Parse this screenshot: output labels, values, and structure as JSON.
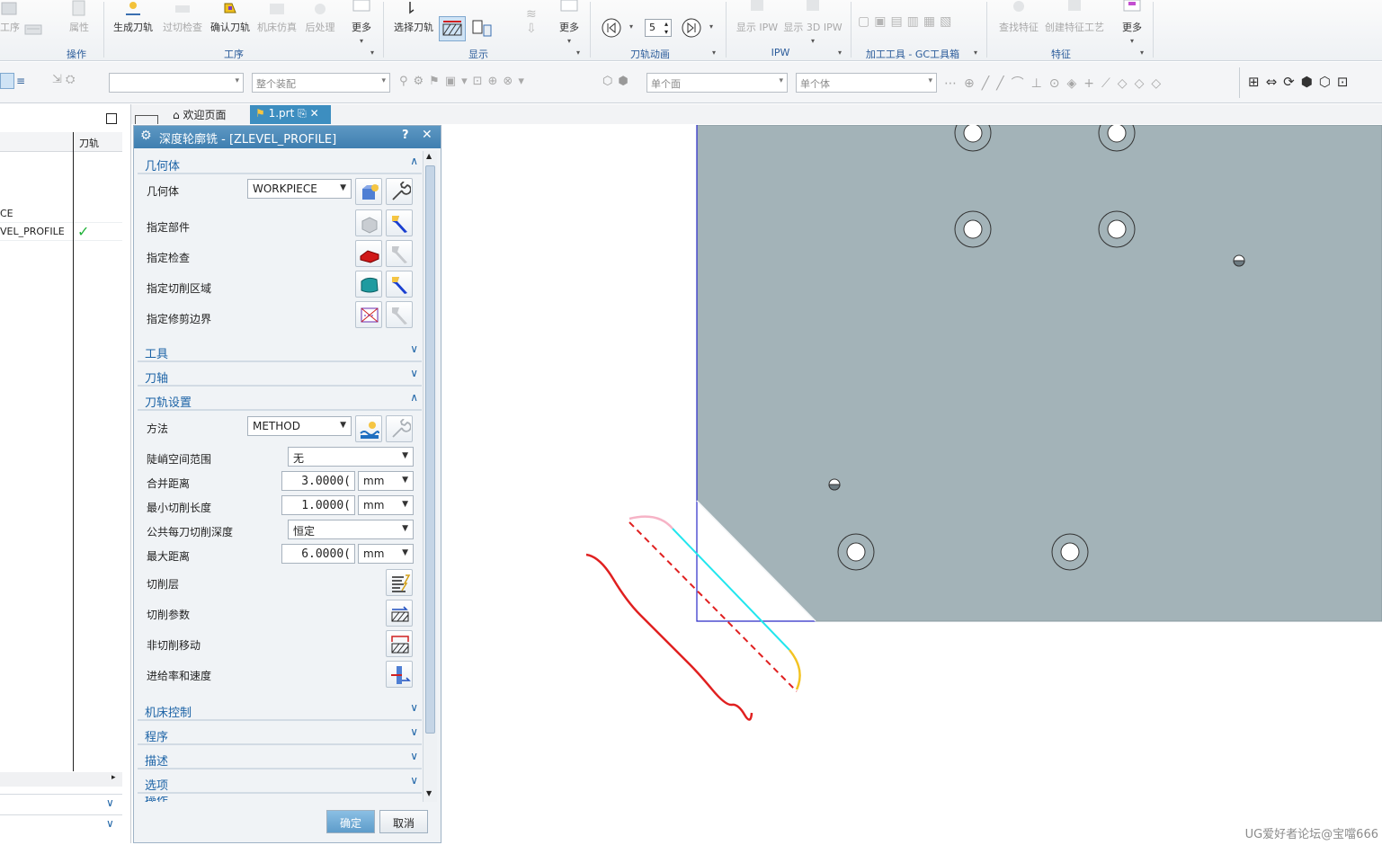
{
  "ribbon": {
    "groups": {
      "operations": "操作",
      "procedure": "工序",
      "display": "显示",
      "toolpath_animation": "刀轨动画",
      "ipw": "IPW",
      "machining_tools": "加工工具 - GC工具箱",
      "features": "特征"
    },
    "buttons": {
      "process": "工序",
      "properties": "属性",
      "generate_toolpath": "生成刀轨",
      "overcut_check": "过切检查",
      "confirm_toolpath": "确认刀轨",
      "machine_simulation": "机床仿真",
      "post_process": "后处理",
      "more1": "更多",
      "select_toolpath": "选择刀轨",
      "more2": "更多",
      "speed_value": "5",
      "show_ipw": "显示 IPW",
      "show_3d_ipw": "显示 3D IPW",
      "find_feature": "查找特征",
      "create_feature_process": "创建特征工艺",
      "more3": "更多"
    }
  },
  "toolbar2": {
    "filter_combo": "",
    "assembly_combo": "整个装配",
    "face_combo1": "单个面",
    "face_combo2": "单个体"
  },
  "navigator": {
    "column_toolpath": "刀轨",
    "rows": [
      {
        "name": "CE",
        "check": ""
      },
      {
        "name": "VEL_PROFILE",
        "check": "✓"
      }
    ]
  },
  "tabs": {
    "welcome": "欢迎页面",
    "file": "1.prt"
  },
  "dialog": {
    "title": "深度轮廓铣 - [ZLEVEL_PROFILE]",
    "help": "?",
    "close": "✕",
    "geometry": {
      "header": "几何体",
      "geometry_label": "几何体",
      "geometry_value": "WORKPIECE",
      "specify_part": "指定部件",
      "specify_check": "指定检查",
      "specify_cut_area": "指定切削区域",
      "specify_trim_boundary": "指定修剪边界"
    },
    "collapsed": {
      "tool": "工具",
      "tool_axis": "刀轴"
    },
    "path_settings": {
      "header": "刀轨设置",
      "method_label": "方法",
      "method_value": "METHOD",
      "steep_label": "陡峭空间范围",
      "steep_value": "无",
      "merge_label": "合并距离",
      "merge_value": "3.0000(",
      "merge_unit": "mm",
      "min_cut_label": "最小切削长度",
      "min_cut_value": "1.0000(",
      "min_cut_unit": "mm",
      "depth_label": "公共每刀切削深度",
      "depth_value": "恒定",
      "max_dist_label": "最大距离",
      "max_dist_value": "6.0000(",
      "max_dist_unit": "mm",
      "cut_levels": "切削层",
      "cut_params": "切削参数",
      "non_cut_moves": "非切削移动",
      "feeds_speeds": "进给率和速度"
    },
    "more_sections": {
      "machine_control": "机床控制",
      "program": "程序",
      "description": "描述",
      "options": "选项",
      "partial": "操作"
    },
    "ok": "确定",
    "cancel": "取消"
  },
  "watermark": "UG爱好者论坛@宝噹666",
  "colors": {
    "part_fill": "#a3b3b8",
    "toolpath_cyan": "#22e6ee",
    "sketch_red": "#e02020",
    "title_blue": "#3f7fb0"
  }
}
